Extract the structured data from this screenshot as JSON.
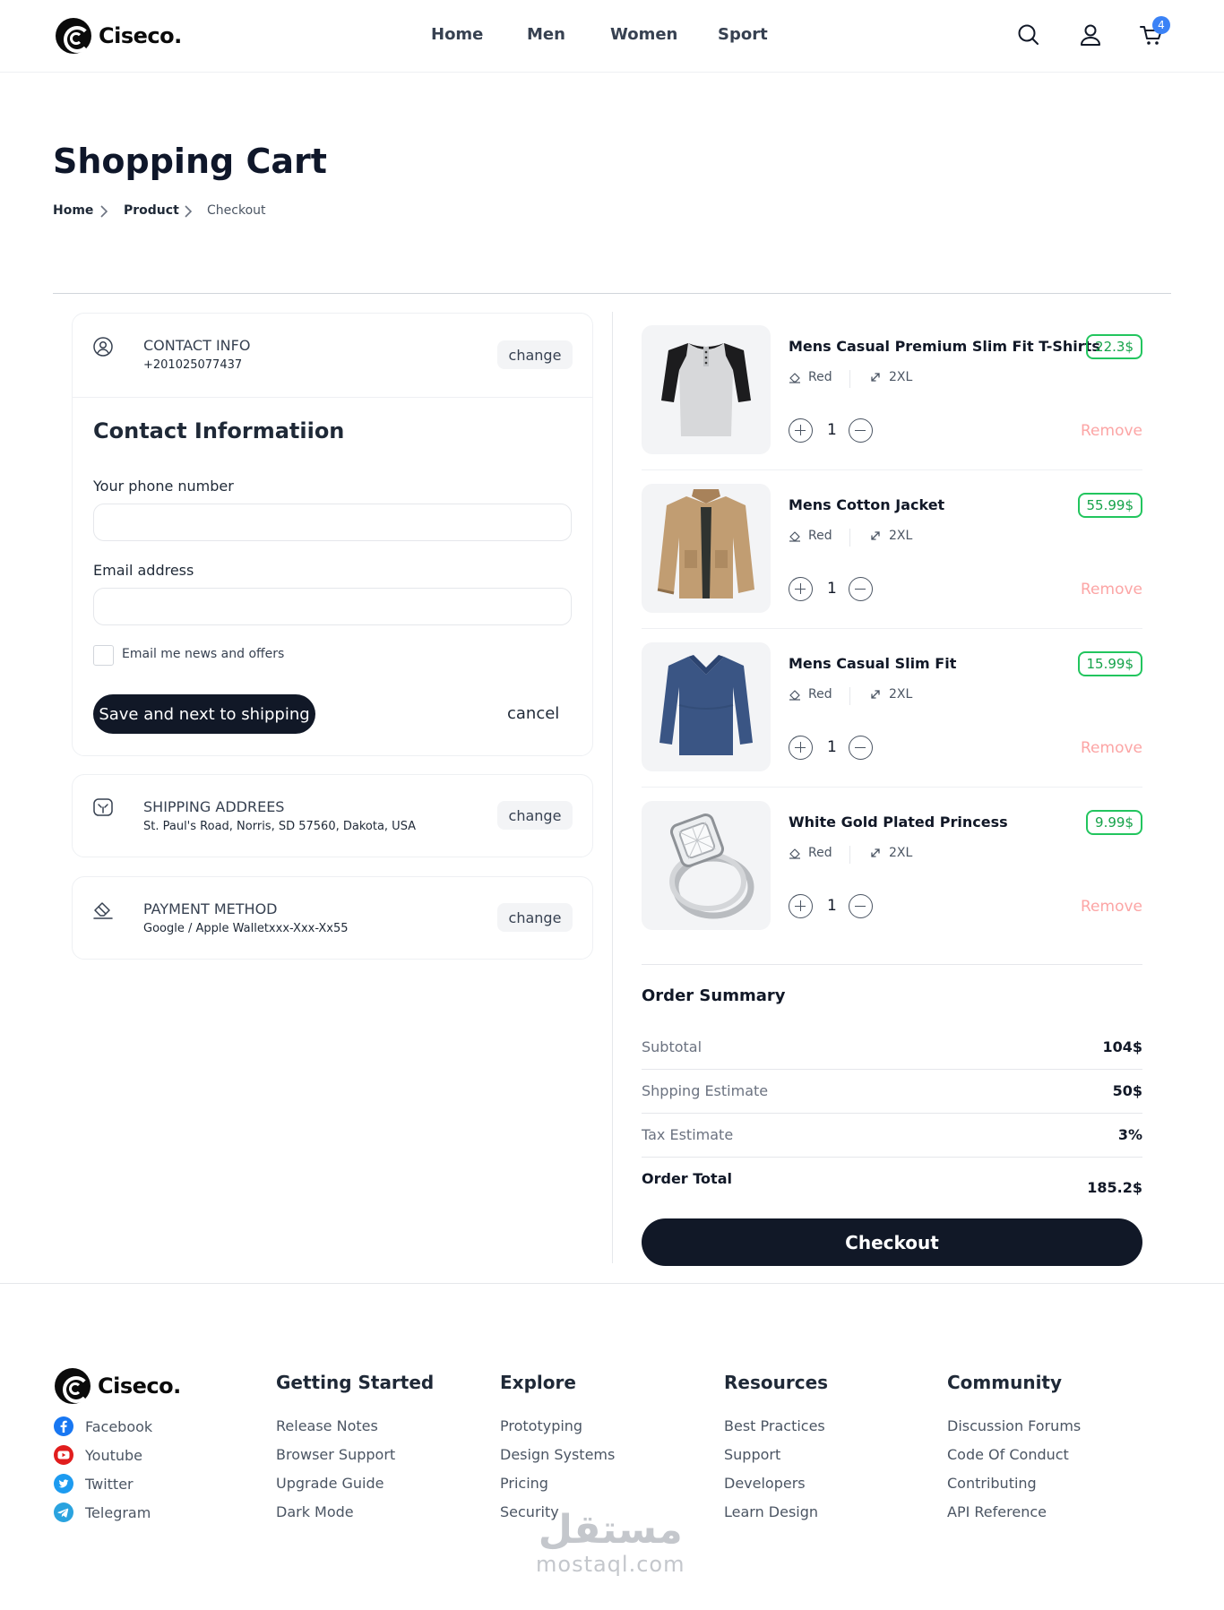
{
  "brand": {
    "name": "Ciseco."
  },
  "nav": {
    "items": [
      "Home",
      "Men",
      "Women",
      "Sport"
    ]
  },
  "header": {
    "cart_count": "4"
  },
  "page": {
    "title": "Shopping Cart"
  },
  "breadcrumb": [
    "Home",
    "Product",
    "Checkout"
  ],
  "contact_card": {
    "title": "CONTACT INFO",
    "value": "+201025077437",
    "change_label": "change"
  },
  "contact_form": {
    "title": "Contact Informatiion",
    "phone_label": "Your phone number",
    "phone_value": "",
    "email_label": "Email address",
    "email_value": "",
    "newsletter_label": "Email me news and offers",
    "save_label": "Save and next to shipping",
    "cancel_label": "cancel"
  },
  "shipping_card": {
    "title": "SHIPPING ADDREES",
    "value": "St. Paul's Road, Norris, SD 57560, Dakota, USA",
    "change_label": "change"
  },
  "payment_card": {
    "title": "PAYMENT METHOD",
    "value": "Google / Apple Walletxxx-Xxx-Xx55",
    "change_label": "change"
  },
  "cart": {
    "items": [
      {
        "name": "Mens Casual Premium Slim Fit T-Shirts",
        "price": "22.3$",
        "color": "Red",
        "size": "2XL",
        "qty": "1",
        "remove": "Remove",
        "image": "raglan-shirt"
      },
      {
        "name": "Mens Cotton Jacket",
        "price": "55.99$",
        "color": "Red",
        "size": "2XL",
        "qty": "1",
        "remove": "Remove",
        "image": "cotton-jacket"
      },
      {
        "name": "Mens Casual Slim Fit",
        "price": "15.99$",
        "color": "Red",
        "size": "2XL",
        "qty": "1",
        "remove": "Remove",
        "image": "navy-longsleeve"
      },
      {
        "name": "White Gold Plated Princess",
        "price": "9.99$",
        "color": "Red",
        "size": "2XL",
        "qty": "1",
        "remove": "Remove",
        "image": "diamond-ring"
      }
    ]
  },
  "summary": {
    "title": "Order Summary",
    "rows": [
      {
        "label": "Subtotal",
        "value": "104$"
      },
      {
        "label": "Shpping Estimate",
        "value": "50$"
      },
      {
        "label": "Tax Estimate",
        "value": "3%"
      }
    ],
    "total_label": "Order Total",
    "total_value": "185.2$",
    "checkout_label": "Checkout"
  },
  "footer": {
    "social": [
      {
        "label": "Facebook",
        "icon": "facebook-icon",
        "color": "#1877f2"
      },
      {
        "label": "Youtube",
        "icon": "youtube-icon",
        "color": "#e11d1d"
      },
      {
        "label": "Twitter",
        "icon": "twitter-icon",
        "color": "#1d9bf0"
      },
      {
        "label": "Telegram",
        "icon": "telegram-icon",
        "color": "#2aa3df"
      }
    ],
    "columns": [
      {
        "title": "Getting Started",
        "links": [
          "Release Notes",
          "Browser Support",
          "Upgrade Guide",
          "Dark Mode"
        ]
      },
      {
        "title": "Explore",
        "links": [
          "Prototyping",
          "Design Systems",
          "Pricing",
          "Security"
        ]
      },
      {
        "title": "Resources",
        "links": [
          "Best Practices",
          "Support",
          "Developers",
          "Learn Design"
        ]
      },
      {
        "title": "Community",
        "links": [
          "Discussion Forums",
          "Code Of Conduct",
          "Contributing",
          "API Reference"
        ]
      }
    ]
  },
  "watermark": {
    "arabic": "مستقل",
    "latin": "mostaql.com"
  },
  "colors": {
    "primary": "#111827",
    "price_green": "#16a34a",
    "remove_pink": "#fca5a5",
    "badge_blue": "#3b82f6"
  }
}
